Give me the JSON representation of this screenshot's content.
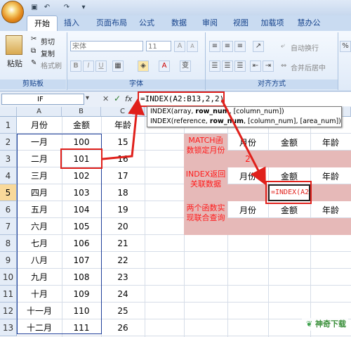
{
  "ribbon_tabs": [
    "开始",
    "插入",
    "页面布局",
    "公式",
    "数据",
    "审阅",
    "视图",
    "加载项",
    "慧办公"
  ],
  "clipboard": {
    "paste": "粘贴",
    "cut": "剪切",
    "copy": "复制",
    "format_painter": "格式刷",
    "label": "剪贴板"
  },
  "font_group": {
    "font_name": "宋体",
    "font_size": "11",
    "label": "字体",
    "bold": "B",
    "italic": "I",
    "underline": "U",
    "grow": "A",
    "shrink": "A"
  },
  "align_group": {
    "wrap": "自动换行",
    "merge": "合并后居中",
    "label": "对齐方式"
  },
  "formula_bar": {
    "name_box": "IF",
    "formula": "=INDEX(A2:B13,2,2)",
    "cancel": "✕",
    "enter": "✓",
    "fx": "fx"
  },
  "tooltip": {
    "line1_a": "INDEX(array, ",
    "line1_b": "row_num",
    ", [column_num])": "",
    "line1_c": ", [column_num])",
    "line2_a": "INDEX(reference, ",
    "line2_b": "row_num",
    "line2_c": ", [column_num], [area_num])"
  },
  "columns": [
    "A",
    "B",
    "C"
  ],
  "rows": [
    "1",
    "2",
    "3",
    "4",
    "5",
    "6",
    "7",
    "8",
    "9",
    "10",
    "11",
    "12",
    "13"
  ],
  "col_a": [
    "月份",
    "一月",
    "二月",
    "三月",
    "四月",
    "五月",
    "六月",
    "七月",
    "八月",
    "九月",
    "十月",
    "十一月",
    "十二月"
  ],
  "col_b": [
    "金额",
    "100",
    "101",
    "102",
    "103",
    "104",
    "105",
    "106",
    "107",
    "108",
    "109",
    "110",
    "111"
  ],
  "col_c": [
    "年龄",
    "15",
    "16",
    "17",
    "18",
    "19",
    "20",
    "21",
    "22",
    "23",
    "24",
    "25",
    "26"
  ],
  "panel": {
    "label1": "MATCH函数锁定月份",
    "label2": "INDEX返回关联数据",
    "label3": "两个函数实现联合查询",
    "h_month": "月份",
    "h_amount": "金额",
    "h_age": "年龄",
    "val_month": "2",
    "active_formula": "=INDEX(A2"
  },
  "watermark": "神奇下载",
  "colors": {
    "accent_red": "#e0201b",
    "pink": "#e6b9b8",
    "selection_blue": "#1f3f9a"
  }
}
